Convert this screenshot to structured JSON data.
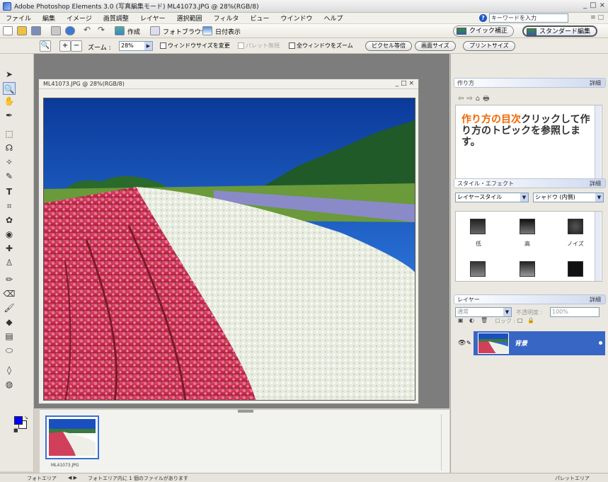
{
  "window": {
    "title": "Adobe Photoshop Elements 3.0 (写真編集モード) ML41073.JPG @ 28%(RGB/8)",
    "controls": [
      "_",
      "□",
      "×"
    ]
  },
  "menu": {
    "items": [
      "ファイル",
      "編集",
      "イメージ",
      "画質調整",
      "レイヤー",
      "選択範囲",
      "フィルタ",
      "ビュー",
      "ウインドウ",
      "ヘルプ"
    ],
    "help_placeholder": "キーワードを入力",
    "right_controls": "≡ □"
  },
  "shortcuts": {
    "create": "作成",
    "photo_browser": "フォトブラウザ",
    "date_view": "日付表示",
    "quick_fix": "クイック補正",
    "standard_edit": "スタンダード編集"
  },
  "options": {
    "zoom_label": "ズーム :",
    "zoom_value": "28%",
    "resize_windows": "ウィンドウサイズを変更",
    "ignore_palettes": "パレット無視",
    "zoom_all": "全ウィンドウをズーム",
    "actual_pixels": "ピクセル等倍",
    "fit_screen": "画面サイズ",
    "print_size": "プリントサイズ"
  },
  "document": {
    "title": "ML41073.JPG @ 28%(RGB/8)",
    "controls": "_ □ ×"
  },
  "photo_bin": {
    "thumbnail_label": "ML41073.JPG"
  },
  "status": {
    "left": "フォトエリア",
    "info": "フォトエリア内に 1 個のファイルがあります",
    "right": "パレットエリア"
  },
  "palettes": {
    "howto": {
      "title": "作り方",
      "more": "詳細",
      "text_highlight": "作り方の目次",
      "text_rest": "クリックして作り方のトピックを参照します。"
    },
    "styles": {
      "title": "スタイル・エフェクト",
      "more": "詳細",
      "category": "レイヤースタイル",
      "set": "シャドウ (内側)",
      "labels": [
        "低",
        "高",
        "ノイズ"
      ]
    },
    "layers": {
      "title": "レイヤー",
      "more": "詳細",
      "blend_mode": "通常",
      "opacity_label": "不透明度 :",
      "opacity_value": "100%",
      "lock_label": "ロック :",
      "layer_name": "背景"
    }
  },
  "colors": {
    "accent": "#3866c4",
    "foreground": "#0000ff",
    "background": "#ffffff"
  }
}
